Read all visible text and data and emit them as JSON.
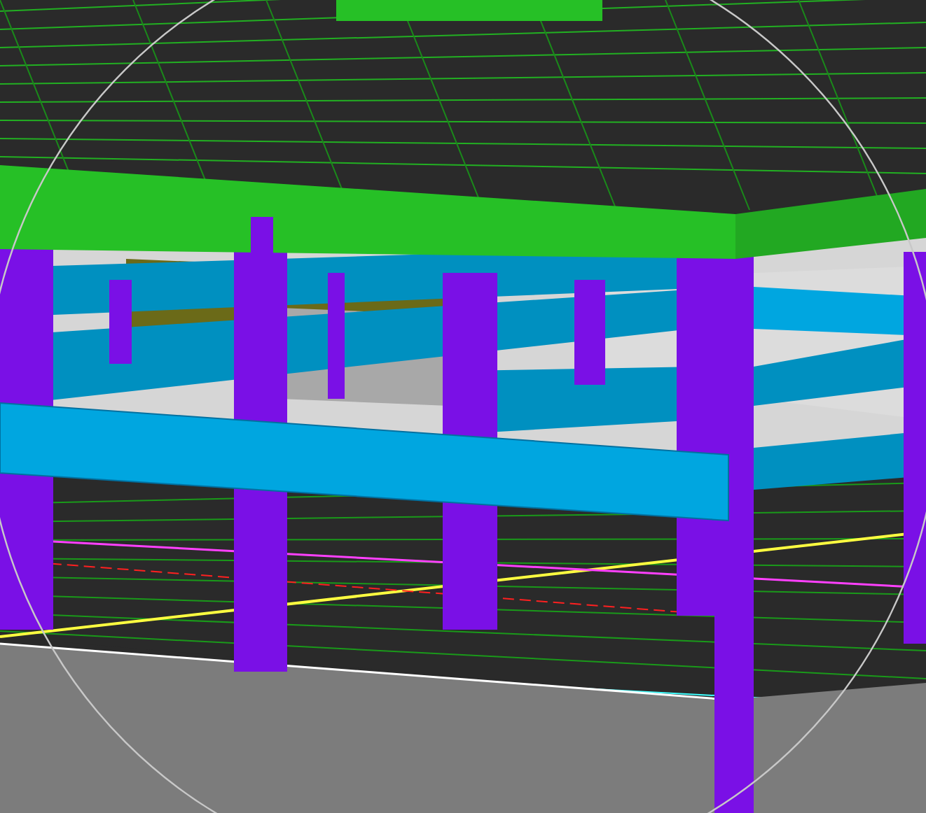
{
  "viewport": {
    "kind": "perspective-3d",
    "navigation_circle": true
  }
}
